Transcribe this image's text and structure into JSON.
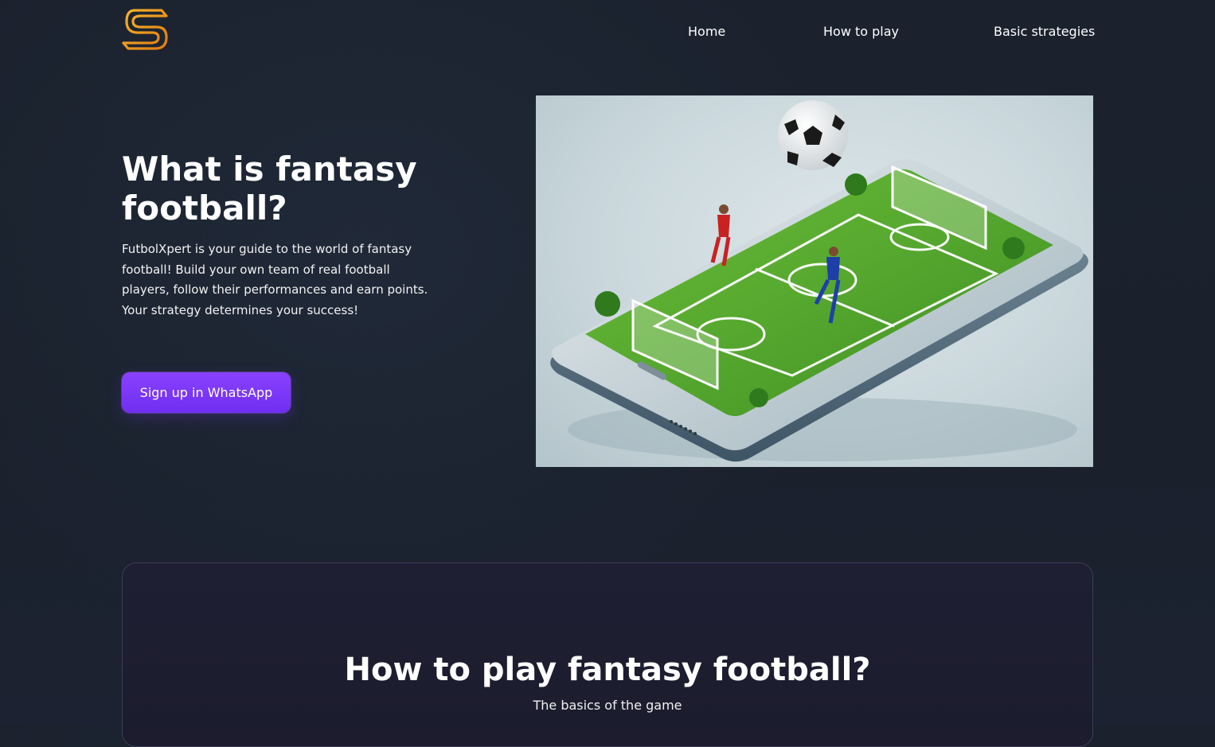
{
  "nav": {
    "logo_icon": "s-logo-icon",
    "links": [
      "Home",
      "How to play",
      "Basic strategies"
    ]
  },
  "hero": {
    "title": "What is fantasy football?",
    "description": "FutbolXpert is your guide to the world of fantasy football! Build your own team of real football players, follow their performances and earn points. Your strategy determines your success!",
    "cta_label": "Sign up in WhatsApp",
    "image_icon": "smartphone-football-pitch-image"
  },
  "how_to_play": {
    "title": "How to play fantasy football?",
    "subtitle": "The basics of the game"
  },
  "colors": {
    "background": "#1b222e",
    "accent": "#7b36f7",
    "logo": "#f0a020",
    "card_border": "#3a3d52"
  }
}
